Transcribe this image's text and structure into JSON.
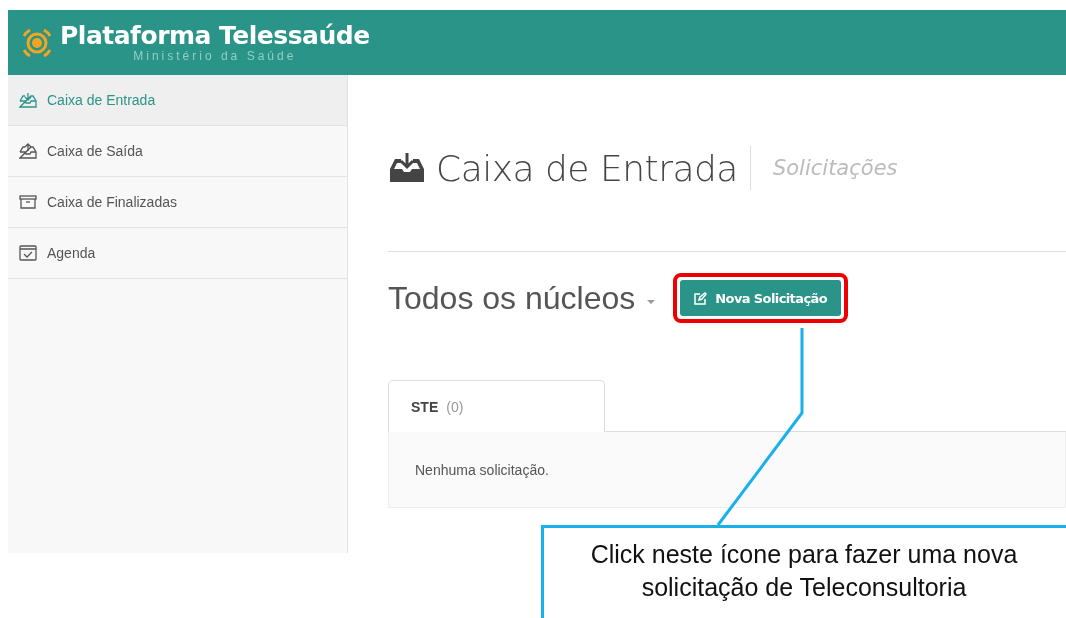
{
  "header": {
    "title": "Plataforma Telessaúde",
    "subtitle": "Ministério da Saúde"
  },
  "sidebar": {
    "items": [
      {
        "label": "Caixa de Entrada",
        "selected": true
      },
      {
        "label": "Caixa de Saída",
        "selected": false
      },
      {
        "label": "Caixa de Finalizadas",
        "selected": false
      },
      {
        "label": "Agenda",
        "selected": false
      }
    ]
  },
  "page": {
    "title": "Caixa de Entrada",
    "subtitle": "Solicitações",
    "filter": "Todos os núcleos",
    "new_button": "Nova Solicitação",
    "tabs": [
      {
        "label": "STE",
        "count": "(0)",
        "selected": true
      }
    ],
    "empty_message": "Nenhuma solicitação."
  },
  "annotation": {
    "text": "Click neste ícone para fazer uma nova solicitação de Teleconsultoria"
  }
}
